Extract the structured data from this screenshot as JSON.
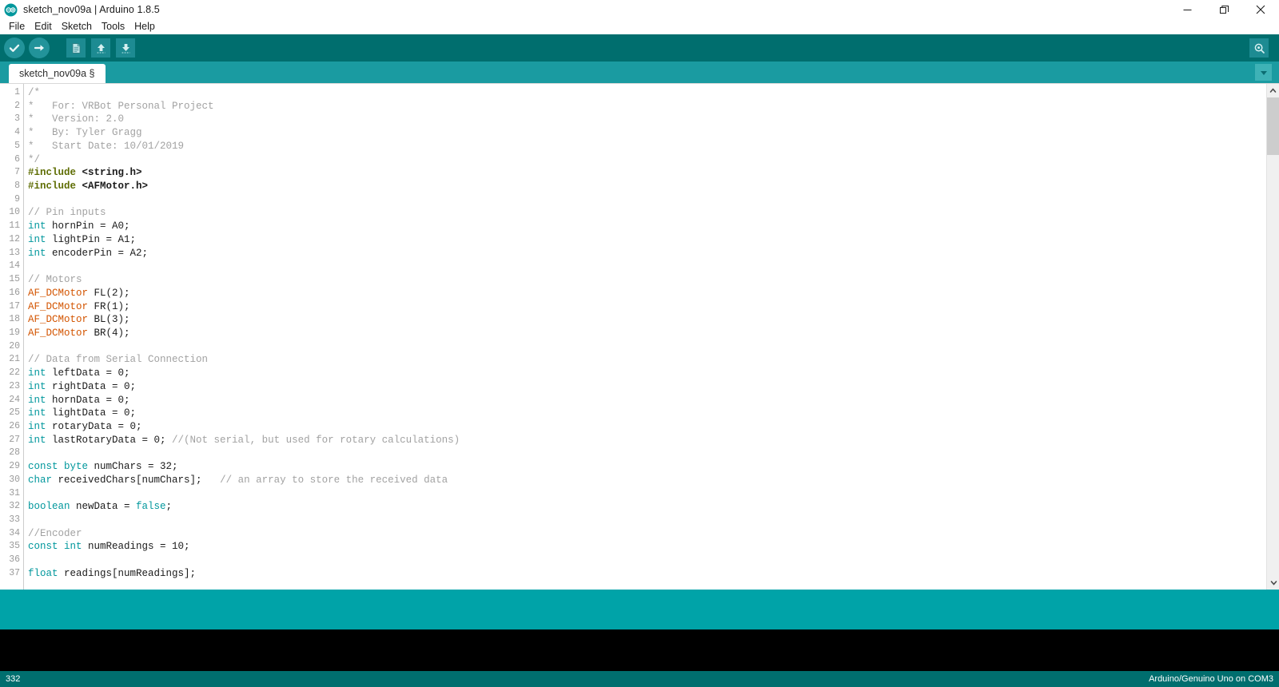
{
  "window": {
    "title": "sketch_nov09a | Arduino 1.8.5",
    "logo_icon": "arduino-infinity-logo",
    "controls": [
      {
        "name": "minimize-button",
        "icon": "minimize-icon"
      },
      {
        "name": "restore-button",
        "icon": "restore-icon"
      },
      {
        "name": "close-button",
        "icon": "close-icon"
      }
    ]
  },
  "menubar": {
    "items": [
      {
        "label": "File"
      },
      {
        "label": "Edit"
      },
      {
        "label": "Sketch"
      },
      {
        "label": "Tools"
      },
      {
        "label": "Help"
      }
    ]
  },
  "toolbar": {
    "verify_label": "Verify",
    "upload_label": "Upload",
    "new_label": "New",
    "open_label": "Open",
    "save_label": "Save",
    "serial_monitor_label": "Serial Monitor",
    "icons": [
      "check-icon",
      "arrow-right-icon",
      "document-icon",
      "arrow-up-icon",
      "arrow-down-icon",
      "magnifier-icon"
    ]
  },
  "tabs": {
    "active_label": "sketch_nov09a §",
    "menu_icon": "chevron-down-icon"
  },
  "editor": {
    "first_line": 1,
    "last_visible_line": 37,
    "scrollbar": {
      "up_icon": "chevron-up-icon",
      "down_icon": "chevron-down-icon"
    },
    "lines": [
      {
        "n": 1,
        "tokens": [
          {
            "c": "cm",
            "t": "/*"
          }
        ]
      },
      {
        "n": 2,
        "tokens": [
          {
            "c": "cm",
            "t": "*   For: VRBot Personal Project"
          }
        ]
      },
      {
        "n": 3,
        "tokens": [
          {
            "c": "cm",
            "t": "*   Version: 2.0"
          }
        ]
      },
      {
        "n": 4,
        "tokens": [
          {
            "c": "cm",
            "t": "*   By: Tyler Gragg"
          }
        ]
      },
      {
        "n": 5,
        "tokens": [
          {
            "c": "cm",
            "t": "*   Start Date: 10/01/2019"
          }
        ]
      },
      {
        "n": 6,
        "tokens": [
          {
            "c": "cm",
            "t": "*/"
          }
        ]
      },
      {
        "n": 7,
        "tokens": [
          {
            "c": "pp",
            "t": "#include"
          },
          {
            "c": "pl",
            "t": " "
          },
          {
            "c": "inc",
            "t": "<string.h>"
          }
        ]
      },
      {
        "n": 8,
        "tokens": [
          {
            "c": "pp",
            "t": "#include"
          },
          {
            "c": "pl",
            "t": " "
          },
          {
            "c": "inc",
            "t": "<AFMotor.h>"
          }
        ]
      },
      {
        "n": 9,
        "tokens": []
      },
      {
        "n": 10,
        "tokens": [
          {
            "c": "cm",
            "t": "// Pin inputs"
          }
        ]
      },
      {
        "n": 11,
        "tokens": [
          {
            "c": "kw",
            "t": "int"
          },
          {
            "c": "pl",
            "t": " hornPin = A0;"
          }
        ]
      },
      {
        "n": 12,
        "tokens": [
          {
            "c": "kw",
            "t": "int"
          },
          {
            "c": "pl",
            "t": " lightPin = A1;"
          }
        ]
      },
      {
        "n": 13,
        "tokens": [
          {
            "c": "kw",
            "t": "int"
          },
          {
            "c": "pl",
            "t": " encoderPin = A2;"
          }
        ]
      },
      {
        "n": 14,
        "tokens": []
      },
      {
        "n": 15,
        "tokens": [
          {
            "c": "cm",
            "t": "// Motors"
          }
        ]
      },
      {
        "n": 16,
        "tokens": [
          {
            "c": "lib",
            "t": "AF_DCMotor"
          },
          {
            "c": "pl",
            "t": " FL(2);"
          }
        ]
      },
      {
        "n": 17,
        "tokens": [
          {
            "c": "lib",
            "t": "AF_DCMotor"
          },
          {
            "c": "pl",
            "t": " FR(1);"
          }
        ]
      },
      {
        "n": 18,
        "tokens": [
          {
            "c": "lib",
            "t": "AF_DCMotor"
          },
          {
            "c": "pl",
            "t": " BL(3);"
          }
        ]
      },
      {
        "n": 19,
        "tokens": [
          {
            "c": "lib",
            "t": "AF_DCMotor"
          },
          {
            "c": "pl",
            "t": " BR(4);"
          }
        ]
      },
      {
        "n": 20,
        "tokens": []
      },
      {
        "n": 21,
        "tokens": [
          {
            "c": "cm",
            "t": "// Data from Serial Connection"
          }
        ]
      },
      {
        "n": 22,
        "tokens": [
          {
            "c": "kw",
            "t": "int"
          },
          {
            "c": "pl",
            "t": " leftData = 0;"
          }
        ]
      },
      {
        "n": 23,
        "tokens": [
          {
            "c": "kw",
            "t": "int"
          },
          {
            "c": "pl",
            "t": " rightData = 0;"
          }
        ]
      },
      {
        "n": 24,
        "tokens": [
          {
            "c": "kw",
            "t": "int"
          },
          {
            "c": "pl",
            "t": " hornData = 0;"
          }
        ]
      },
      {
        "n": 25,
        "tokens": [
          {
            "c": "kw",
            "t": "int"
          },
          {
            "c": "pl",
            "t": " lightData = 0;"
          }
        ]
      },
      {
        "n": 26,
        "tokens": [
          {
            "c": "kw",
            "t": "int"
          },
          {
            "c": "pl",
            "t": " rotaryData = 0;"
          }
        ]
      },
      {
        "n": 27,
        "tokens": [
          {
            "c": "kw",
            "t": "int"
          },
          {
            "c": "pl",
            "t": " lastRotaryData = 0; "
          },
          {
            "c": "cm",
            "t": "//(Not serial, but used for rotary calculations)"
          }
        ]
      },
      {
        "n": 28,
        "tokens": []
      },
      {
        "n": 29,
        "tokens": [
          {
            "c": "kw",
            "t": "const byte"
          },
          {
            "c": "pl",
            "t": " numChars = 32;"
          }
        ]
      },
      {
        "n": 30,
        "tokens": [
          {
            "c": "kw",
            "t": "char"
          },
          {
            "c": "pl",
            "t": " receivedChars[numChars];   "
          },
          {
            "c": "cm",
            "t": "// an array to store the received data"
          }
        ]
      },
      {
        "n": 31,
        "tokens": []
      },
      {
        "n": 32,
        "tokens": [
          {
            "c": "kw",
            "t": "boolean"
          },
          {
            "c": "pl",
            "t": " newData = "
          },
          {
            "c": "lit",
            "t": "false"
          },
          {
            "c": "pl",
            "t": ";"
          }
        ]
      },
      {
        "n": 33,
        "tokens": []
      },
      {
        "n": 34,
        "tokens": [
          {
            "c": "cm",
            "t": "//Encoder"
          }
        ]
      },
      {
        "n": 35,
        "tokens": [
          {
            "c": "kw",
            "t": "const int"
          },
          {
            "c": "pl",
            "t": " numReadings = 10;"
          }
        ]
      },
      {
        "n": 36,
        "tokens": []
      },
      {
        "n": 37,
        "tokens": [
          {
            "c": "kw",
            "t": "float"
          },
          {
            "c": "pl",
            "t": " readings[numReadings];"
          }
        ]
      }
    ]
  },
  "statusbar": {
    "line_number": "332",
    "board_info": "Arduino/Genuino Uno on COM3"
  },
  "colors": {
    "toolbar_teal": "#006e6e",
    "tabbar_teal": "#1a9ba1",
    "status_band_teal": "#00a3a8",
    "console_black": "#000000",
    "keyword": "#00979c",
    "comment": "#a2a2a2",
    "library_class": "#d35400",
    "preprocessor": "#5e6d03"
  }
}
